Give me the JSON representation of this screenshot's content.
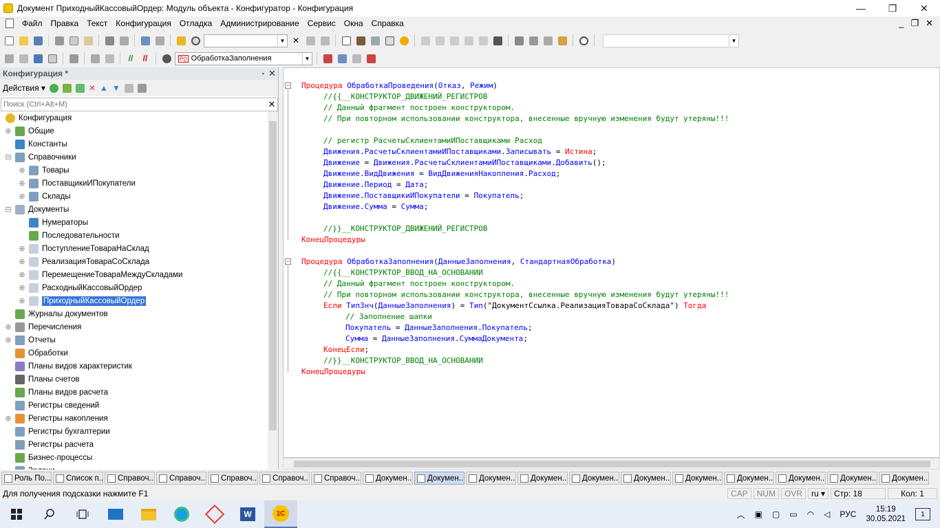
{
  "window": {
    "title": "Документ ПриходныйКассовыйОрдер: Модуль объекта - Конфигуратор - Конфигурация",
    "btn_min": "—",
    "btn_max": "❐",
    "btn_close": "✕"
  },
  "menu": [
    "Файл",
    "Правка",
    "Текст",
    "Конфигурация",
    "Отладка",
    "Администрирование",
    "Сервис",
    "Окна",
    "Справка"
  ],
  "menu_right": {
    "min": "_",
    "restore": "❐",
    "close": "✕"
  },
  "toolbar2": {
    "procedure_combo": "ОбработкаЗаполнения",
    "proc_badge": "P()"
  },
  "panel": {
    "title": "Конфигурация *",
    "pin": "▪",
    "close": "✕",
    "actions_label": "Действия",
    "search_placeholder": "Поиск (Ctrl+Alt+M)",
    "search_clear": "✕"
  },
  "tree": [
    {
      "label": "Конфигурация",
      "level": 0,
      "exp": "",
      "icon": "#e8b820",
      "round": true
    },
    {
      "label": "Общие",
      "level": 1,
      "exp": "⊕",
      "icon": "#6aa84f"
    },
    {
      "label": "Константы",
      "level": 1,
      "exp": "",
      "icon": "#3d85c6"
    },
    {
      "label": "Справочники",
      "level": 1,
      "exp": "⊟",
      "icon": "#7f9fbf"
    },
    {
      "label": "Товары",
      "level": 2,
      "exp": "⊕",
      "icon": "#7f9fbf"
    },
    {
      "label": "ПоставщикиИПокупатели",
      "level": 2,
      "exp": "⊕",
      "icon": "#7f9fbf"
    },
    {
      "label": "Склады",
      "level": 2,
      "exp": "⊕",
      "icon": "#7f9fbf"
    },
    {
      "label": "Документы",
      "level": 1,
      "exp": "⊟",
      "icon": "#9fb0c8"
    },
    {
      "label": "Нумераторы",
      "level": 2,
      "exp": "",
      "icon": "#3d85c6"
    },
    {
      "label": "Последовательности",
      "level": 2,
      "exp": "",
      "icon": "#6aa84f"
    },
    {
      "label": "ПоступлениеТовараНаСклад",
      "level": 2,
      "exp": "⊕",
      "icon": "#c8d0dc"
    },
    {
      "label": "РеализацияТовараСоСклада",
      "level": 2,
      "exp": "⊕",
      "icon": "#c8d0dc"
    },
    {
      "label": "ПеремещениеТовараМеждуСкладами",
      "level": 2,
      "exp": "⊕",
      "icon": "#c8d0dc"
    },
    {
      "label": "РасходныйКассовыйОрдер",
      "level": 2,
      "exp": "⊕",
      "icon": "#c8d0dc"
    },
    {
      "label": "ПриходныйКассовыйОрдер",
      "level": 2,
      "exp": "⊕",
      "icon": "#c8d0dc",
      "selected": true
    },
    {
      "label": "Журналы документов",
      "level": 1,
      "exp": "",
      "icon": "#6aa84f"
    },
    {
      "label": "Перечисления",
      "level": 1,
      "exp": "⊕",
      "icon": "#999999"
    },
    {
      "label": "Отчеты",
      "level": 1,
      "exp": "⊕",
      "icon": "#7f9fbf"
    },
    {
      "label": "Обработки",
      "level": 1,
      "exp": "",
      "icon": "#e69138"
    },
    {
      "label": "Планы видов характеристик",
      "level": 1,
      "exp": "",
      "icon": "#8e7cc3"
    },
    {
      "label": "Планы счетов",
      "level": 1,
      "exp": "",
      "icon": "#666666"
    },
    {
      "label": "Планы видов расчета",
      "level": 1,
      "exp": "",
      "icon": "#6aa84f"
    },
    {
      "label": "Регистры сведений",
      "level": 1,
      "exp": "",
      "icon": "#7f9fbf"
    },
    {
      "label": "Регистры накопления",
      "level": 1,
      "exp": "⊕",
      "icon": "#e69138"
    },
    {
      "label": "Регистры бухгалтерии",
      "level": 1,
      "exp": "",
      "icon": "#7f9fbf"
    },
    {
      "label": "Регистры расчета",
      "level": 1,
      "exp": "",
      "icon": "#7f9fbf"
    },
    {
      "label": "Бизнес-процессы",
      "level": 1,
      "exp": "",
      "icon": "#6aa84f"
    },
    {
      "label": "Задачи",
      "level": 1,
      "exp": "",
      "icon": "#7f9fbf"
    }
  ],
  "code": [
    {
      "indent": 0,
      "fold": "⊟",
      "parts": [
        [
          "kw",
          "Процедура "
        ],
        [
          "id",
          "ОбработкаПроведения"
        ],
        [
          "st",
          "("
        ],
        [
          "id",
          "Отказ"
        ],
        [
          "st",
          ", "
        ],
        [
          "id",
          "Режим"
        ],
        [
          "st",
          ")"
        ]
      ]
    },
    {
      "indent": 1,
      "parts": [
        [
          "cm",
          "//{{__КОНСТРУКТОР_ДВИЖЕНИЙ_РЕГИСТРОВ"
        ]
      ]
    },
    {
      "indent": 1,
      "parts": [
        [
          "cm",
          "// Данный фрагмент построен конструктором."
        ]
      ]
    },
    {
      "indent": 1,
      "parts": [
        [
          "cm",
          "// При повторном использовании конструктора, внесенные вручную изменения будут утеряны!!!"
        ]
      ]
    },
    {
      "indent": 0,
      "parts": []
    },
    {
      "indent": 1,
      "parts": [
        [
          "cm",
          "// регистр РасчетыСклиентамиИПоставщиками Расход"
        ]
      ]
    },
    {
      "indent": 1,
      "parts": [
        [
          "id",
          "Движения"
        ],
        [
          "st",
          "."
        ],
        [
          "id",
          "РасчетыСклиентамиИПоставщиками"
        ],
        [
          "st",
          "."
        ],
        [
          "id",
          "Записывать"
        ],
        [
          "st",
          " = "
        ],
        [
          "kw",
          "Истина"
        ],
        [
          "st",
          ";"
        ]
      ]
    },
    {
      "indent": 1,
      "parts": [
        [
          "id",
          "Движение"
        ],
        [
          "st",
          " = "
        ],
        [
          "id",
          "Движения"
        ],
        [
          "st",
          "."
        ],
        [
          "id",
          "РасчетыСклиентамиИПоставщиками"
        ],
        [
          "st",
          "."
        ],
        [
          "id",
          "Добавить"
        ],
        [
          "st",
          "();"
        ]
      ]
    },
    {
      "indent": 1,
      "parts": [
        [
          "id",
          "Движение"
        ],
        [
          "st",
          "."
        ],
        [
          "id",
          "ВидДвижения"
        ],
        [
          "st",
          " = "
        ],
        [
          "id",
          "ВидДвиженияНакопления"
        ],
        [
          "st",
          "."
        ],
        [
          "id",
          "Расход"
        ],
        [
          "st",
          ";"
        ]
      ]
    },
    {
      "indent": 1,
      "parts": [
        [
          "id",
          "Движение"
        ],
        [
          "st",
          "."
        ],
        [
          "id",
          "Период"
        ],
        [
          "st",
          " = "
        ],
        [
          "id",
          "Дата"
        ],
        [
          "st",
          ";"
        ]
      ]
    },
    {
      "indent": 1,
      "parts": [
        [
          "id",
          "Движение"
        ],
        [
          "st",
          "."
        ],
        [
          "id",
          "ПоставщикиИПокупатели"
        ],
        [
          "st",
          " = "
        ],
        [
          "id",
          "Покупатель"
        ],
        [
          "st",
          ";"
        ]
      ]
    },
    {
      "indent": 1,
      "parts": [
        [
          "id",
          "Движение"
        ],
        [
          "st",
          "."
        ],
        [
          "id",
          "Сумма"
        ],
        [
          "st",
          " = "
        ],
        [
          "id",
          "Сумма"
        ],
        [
          "st",
          ";"
        ]
      ]
    },
    {
      "indent": 0,
      "parts": []
    },
    {
      "indent": 1,
      "parts": [
        [
          "cm",
          "//}}__КОНСТРУКТОР_ДВИЖЕНИЙ_РЕГИСТРОВ"
        ]
      ]
    },
    {
      "indent": 0,
      "parts": [
        [
          "kw",
          "КонецПроцедуры"
        ]
      ]
    },
    {
      "indent": 0,
      "parts": []
    },
    {
      "indent": 0,
      "fold": "⊟",
      "parts": [
        [
          "kw",
          "Процедура "
        ],
        [
          "id",
          "ОбработкаЗаполнения"
        ],
        [
          "st",
          "("
        ],
        [
          "id",
          "ДанныеЗаполнения"
        ],
        [
          "st",
          ", "
        ],
        [
          "id",
          "СтандартнаяОбработка"
        ],
        [
          "st",
          ")"
        ]
      ]
    },
    {
      "indent": 1,
      "parts": [
        [
          "cm",
          "//{{__КОНСТРУКТОР_ВВОД_НА_ОСНОВАНИИ"
        ]
      ]
    },
    {
      "indent": 1,
      "parts": [
        [
          "cm",
          "// Данный фрагмент построен конструктором."
        ]
      ]
    },
    {
      "indent": 1,
      "parts": [
        [
          "cm",
          "// При повторном использовании конструктора, внесенные вручную изменения будут утеряны!!!"
        ]
      ]
    },
    {
      "indent": 1,
      "parts": [
        [
          "kw",
          "Если "
        ],
        [
          "id",
          "ТипЗнч"
        ],
        [
          "st",
          "("
        ],
        [
          "id",
          "ДанныеЗаполнения"
        ],
        [
          "st",
          ") = "
        ],
        [
          "id",
          "Тип"
        ],
        [
          "st",
          "(\"ДокументСсылка.РеализацияТовараСоСклада\") "
        ],
        [
          "kw",
          "Тогда"
        ]
      ]
    },
    {
      "indent": 2,
      "parts": [
        [
          "cm",
          "// Заполнение шапки"
        ]
      ]
    },
    {
      "indent": 2,
      "parts": [
        [
          "id",
          "Покупатель"
        ],
        [
          "st",
          " = "
        ],
        [
          "id",
          "ДанныеЗаполнения"
        ],
        [
          "st",
          "."
        ],
        [
          "id",
          "Покупатель"
        ],
        [
          "st",
          ";"
        ]
      ]
    },
    {
      "indent": 2,
      "parts": [
        [
          "id",
          "Сумма"
        ],
        [
          "st",
          " = "
        ],
        [
          "id",
          "ДанныеЗаполнения"
        ],
        [
          "st",
          "."
        ],
        [
          "id",
          "СуммаДокумента"
        ],
        [
          "st",
          ";"
        ]
      ]
    },
    {
      "indent": 1,
      "parts": [
        [
          "kw",
          "КонецЕсли"
        ],
        [
          "st",
          ";"
        ]
      ]
    },
    {
      "indent": 1,
      "parts": [
        [
          "cm",
          "//}}__КОНСТРУКТОР_ВВОД_НА_ОСНОВАНИИ"
        ]
      ]
    },
    {
      "indent": 0,
      "parts": [
        [
          "kw",
          "КонецПроцедуры"
        ]
      ]
    }
  ],
  "window_tabs": [
    {
      "label": "Роль По...",
      "active": false
    },
    {
      "label": "Список п...",
      "active": false
    },
    {
      "label": "Справоч...",
      "active": false
    },
    {
      "label": "Справоч...",
      "active": false
    },
    {
      "label": "Справоч...",
      "active": false
    },
    {
      "label": "Справоч...",
      "active": false
    },
    {
      "label": "Справоч...",
      "active": false
    },
    {
      "label": "Докумен...",
      "active": false
    },
    {
      "label": "Докумен...",
      "active": true
    },
    {
      "label": "Докумен...",
      "active": false
    },
    {
      "label": "Докумен...",
      "active": false
    },
    {
      "label": "Докумен...",
      "active": false
    },
    {
      "label": "Докумен...",
      "active": false
    },
    {
      "label": "Докумен...",
      "active": false
    },
    {
      "label": "Докумен...",
      "active": false
    },
    {
      "label": "Докумен...",
      "active": false
    },
    {
      "label": "Докумен...",
      "active": false
    },
    {
      "label": "Докумен...",
      "active": false
    }
  ],
  "status": {
    "hint": "Для получения подсказки нажмите F1",
    "cap": "CAP",
    "num": "NUM",
    "ovr": "OVR",
    "lang": "ru",
    "line": "Стр: 18",
    "col": "Кол: 1"
  },
  "taskbar": {
    "lang": "РУС",
    "time": "15:19",
    "date": "30.05.2021",
    "notif": "1",
    "word": "W",
    "onec": "1С"
  }
}
